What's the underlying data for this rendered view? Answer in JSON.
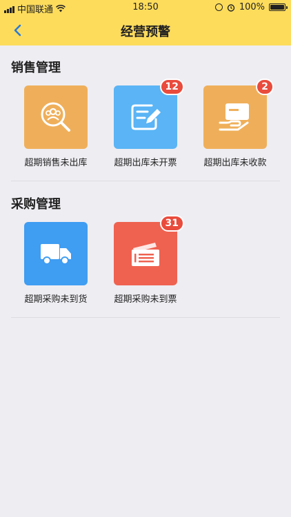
{
  "status_bar": {
    "carrier": "中国联通",
    "time": "18:50",
    "battery": "100%"
  },
  "nav": {
    "title": "经营预警"
  },
  "sections": [
    {
      "title": "销售管理",
      "items": [
        {
          "label": "超期销售未出库",
          "icon": "customer-search-icon",
          "color": "#efaf5a",
          "badge": ""
        },
        {
          "label": "超期出库未开票",
          "icon": "edit-document-icon",
          "color": "#5ab4f5",
          "badge": "12"
        },
        {
          "label": "超期出库未收款",
          "icon": "payment-hand-icon",
          "color": "#efaf5a",
          "badge": "2"
        }
      ]
    },
    {
      "title": "采购管理",
      "items": [
        {
          "label": "超期采购未到货",
          "icon": "delivery-truck-icon",
          "color": "#3f9df2",
          "badge": ""
        },
        {
          "label": "超期采购未到票",
          "icon": "invoice-tickets-icon",
          "color": "#ef6250",
          "badge": "31"
        }
      ]
    }
  ],
  "colors": {
    "header": "#fddc5c",
    "background": "#eeedf2",
    "badge": "#e94b3c",
    "back_arrow": "#2a7ad6"
  }
}
